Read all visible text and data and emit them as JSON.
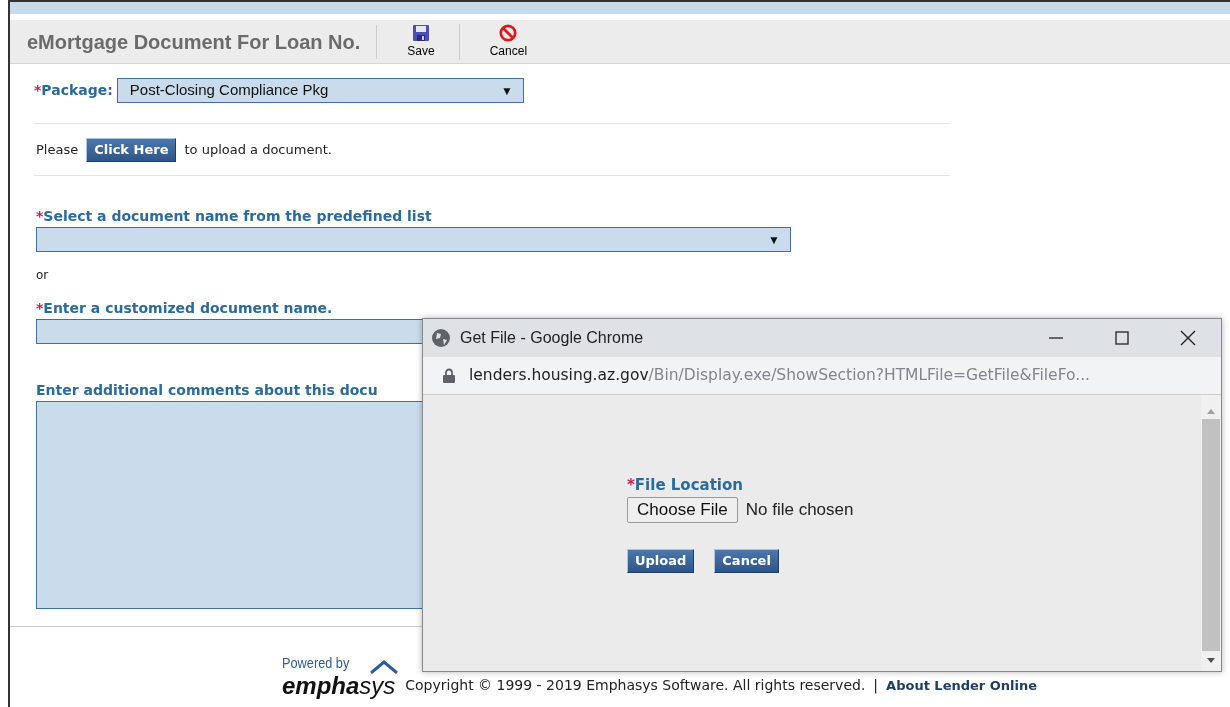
{
  "header": {
    "title": "eMortgage Document For Loan No.",
    "toolbar": [
      {
        "kind": "save",
        "label": "Save"
      },
      {
        "kind": "cancel",
        "label": "Cancel"
      }
    ]
  },
  "form": {
    "package": {
      "required_mark": "*",
      "label": "Package:",
      "value": "Post-Closing Compliance Pkg",
      "arrow": "▼"
    },
    "upload_prompt": {
      "before": "Please",
      "button": "Click Here",
      "after": "to upload a document."
    },
    "predefined": {
      "required_mark": "*",
      "label": "Select a document name from the predefined list",
      "arrow": "▼"
    },
    "or_text": "or",
    "custom": {
      "required_mark": "*",
      "label": "Enter a customized document name."
    },
    "comments": {
      "label": "Enter additional comments about this docu"
    }
  },
  "footer": {
    "powered_by": "Powered by",
    "logo": "**empha**sys",
    "copyright": "Copyright © 1999 - 2019 Emphasys Software. All rights reserved.",
    "separator": "|",
    "link": "About Lender Online"
  },
  "popup": {
    "title": "Get File - Google Chrome",
    "url_host": "lenders.housing.az.gov",
    "url_path": "/Bin/Display.exe/ShowSection?HTMLFile=GetFile&FileFo...",
    "file_label": {
      "required_mark": "*",
      "label": "File Location"
    },
    "choose_button": "Choose File",
    "file_status": "No file chosen",
    "buttons": [
      "Upload",
      "Cancel"
    ]
  }
}
